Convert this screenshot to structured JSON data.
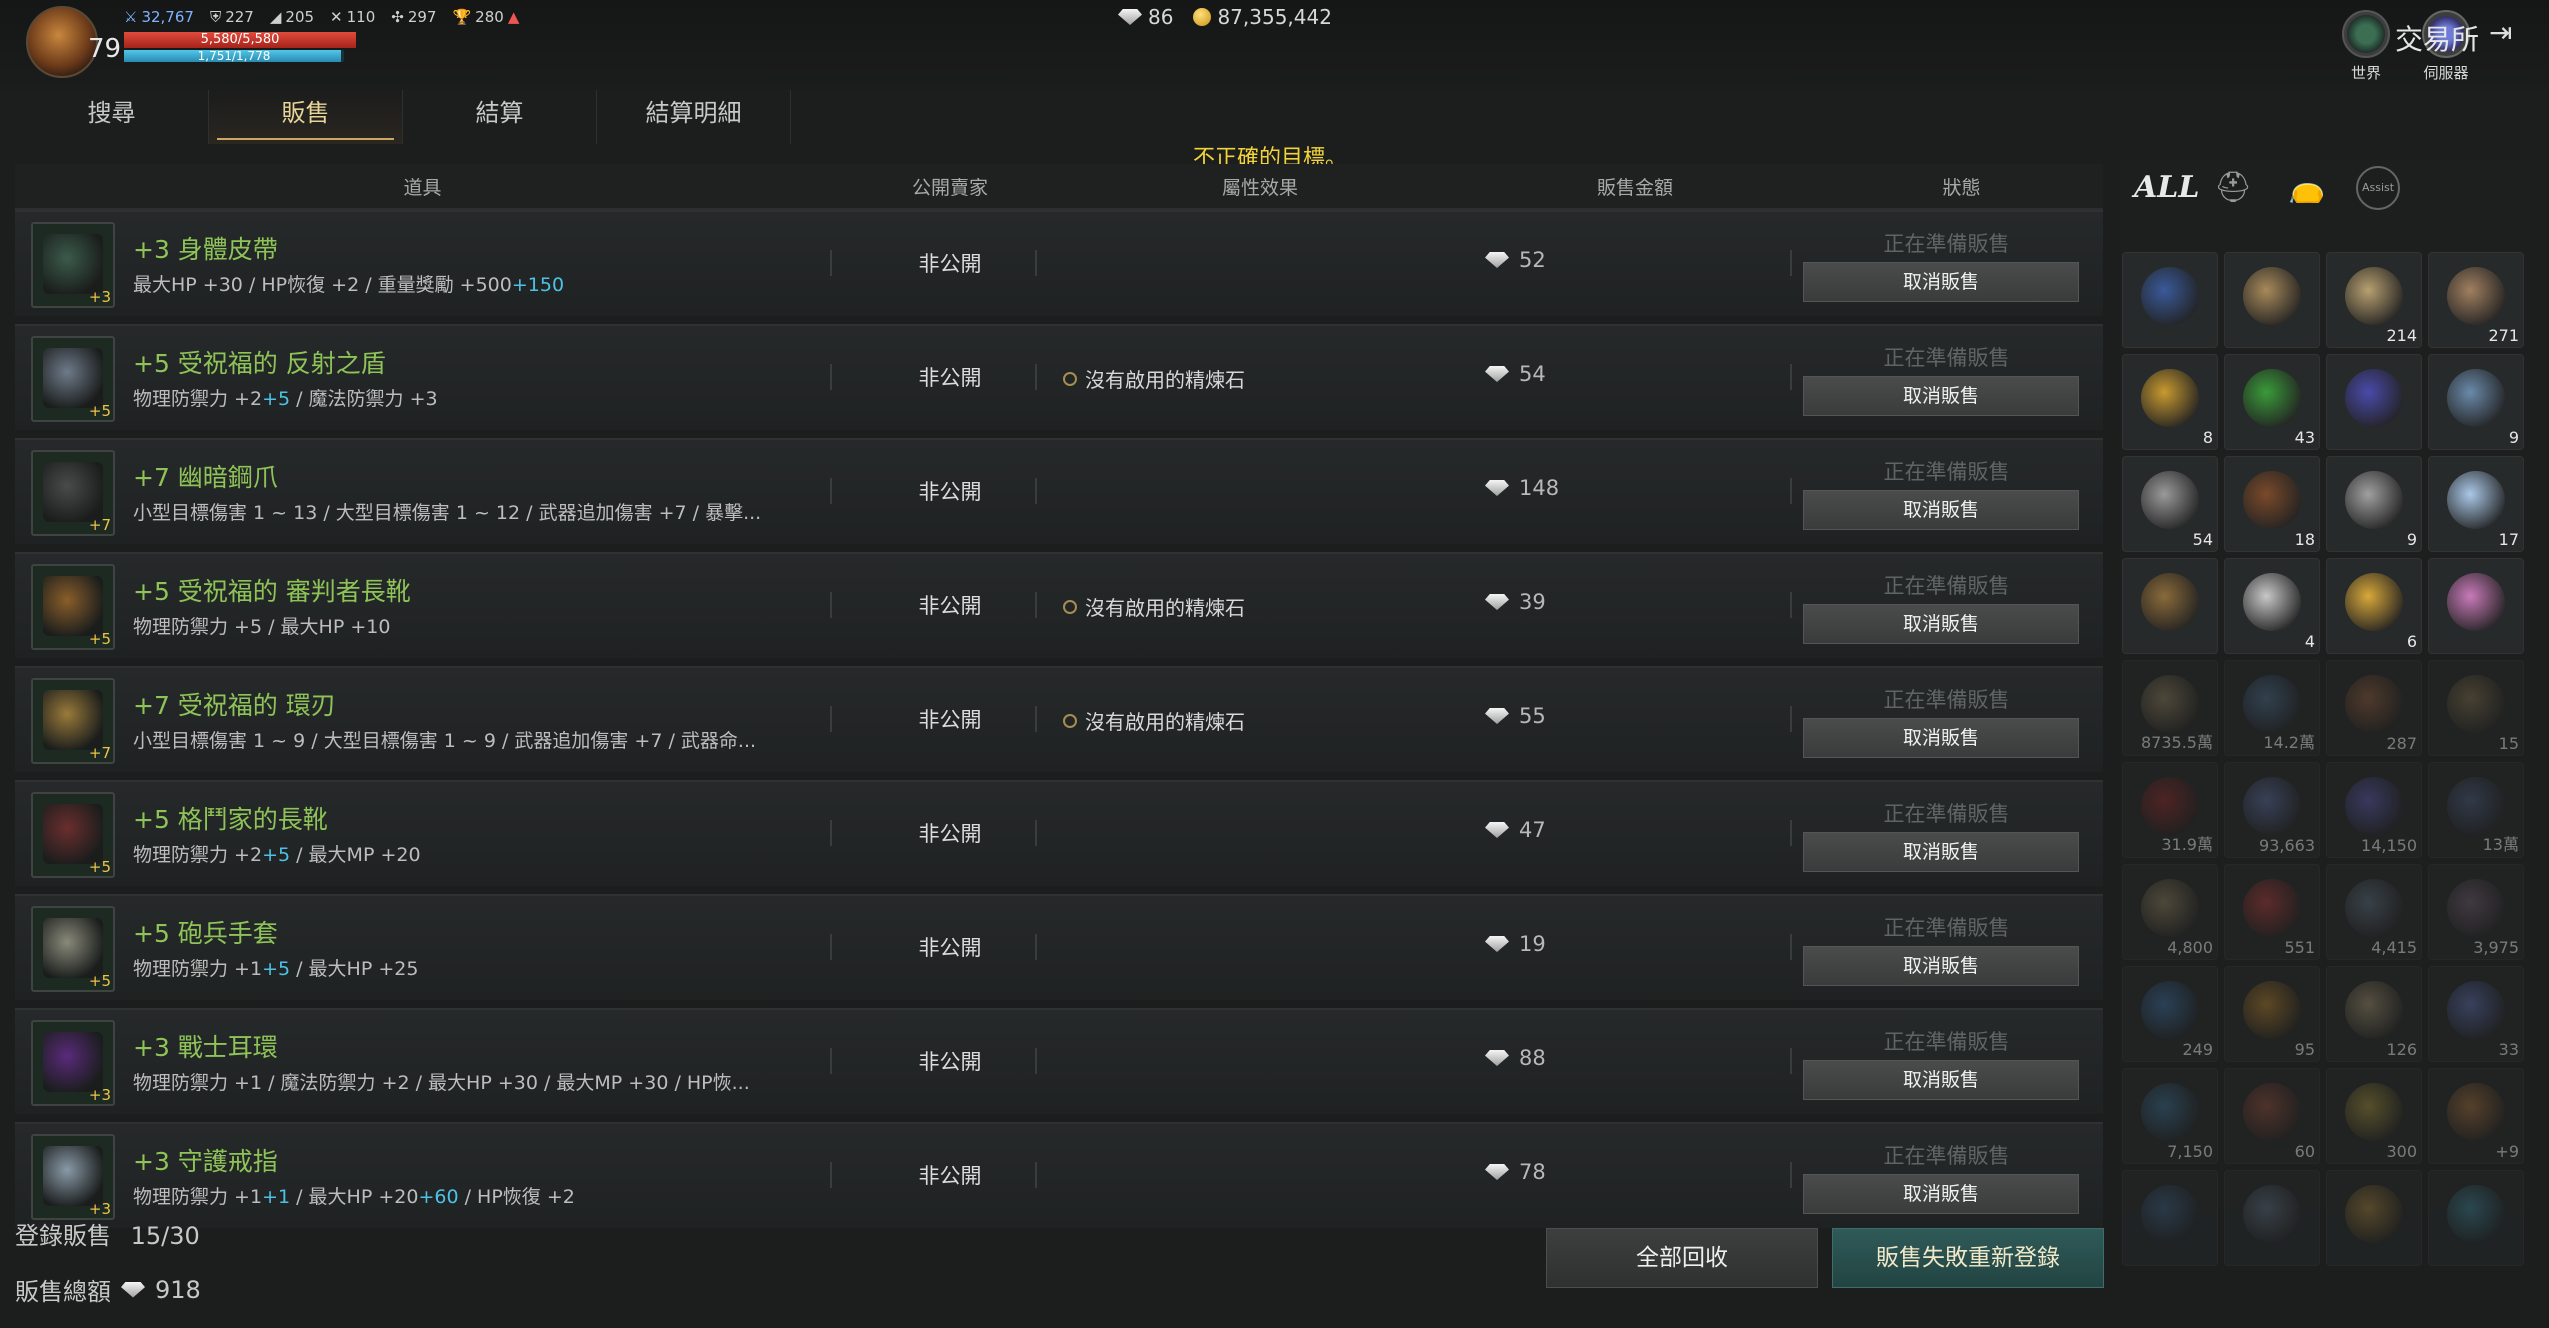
{
  "hud": {
    "level": "79",
    "stats": [
      "32,767",
      "227",
      "205",
      "110",
      "297",
      "280"
    ],
    "hp_text": "5,580/5,580",
    "mp_text": "1,751/1,778",
    "hp_fraction": 1.0,
    "mp_fraction": 0.985,
    "diamonds": "86",
    "gold": "87,355,442",
    "world_label": "世界",
    "server_label": "伺服器",
    "market_title": "交易所"
  },
  "tabs": [
    "搜尋",
    "販售",
    "結算",
    "結算明細"
  ],
  "active_tab": 1,
  "error_message": "不正確的目標。",
  "headers": {
    "item": "道具",
    "seller": "公開賣家",
    "attr": "屬性效果",
    "price": "販售金額",
    "status": "狀態"
  },
  "rows": [
    {
      "icon": "belt-icon",
      "plus": "+3",
      "name": "+3 身體皮帶",
      "desc": "最大HP +30 / HP恢復 +2 / 重量獎勵 +500",
      "desc_extra": "+150",
      "seller": "非公開",
      "attr": "",
      "price": "52",
      "status": "正在準備販售",
      "cancel": "取消販售",
      "color": "#3b5b4a"
    },
    {
      "icon": "shield-icon",
      "plus": "+5",
      "name": "+5 受祝福的 反射之盾",
      "desc": "物理防禦力 +2",
      "desc_extra": "+5",
      "desc_tail": " / 魔法防禦力 +3",
      "seller": "非公開",
      "attr": "沒有啟用的精煉石",
      "price": "54",
      "status": "正在準備販售",
      "cancel": "取消販售",
      "color": "#6f7a8a"
    },
    {
      "icon": "claw-icon",
      "plus": "+7",
      "name": "+7 幽暗鋼爪",
      "desc": "小型目標傷害 1 ~ 13 / 大型目標傷害 1 ~ 12 / 武器追加傷害 +7 / 暴擊...",
      "seller": "非公開",
      "attr": "",
      "price": "148",
      "status": "正在準備販售",
      "cancel": "取消販售",
      "color": "#4a4a4a"
    },
    {
      "icon": "boots-icon",
      "plus": "+5",
      "name": "+5 受祝福的 審判者長靴",
      "desc": "物理防禦力 +5 / 最大HP +10",
      "seller": "非公開",
      "attr": "沒有啟用的精煉石",
      "price": "39",
      "status": "正在準備販售",
      "cancel": "取消販售",
      "color": "#8a5e2a"
    },
    {
      "icon": "ring-blade-icon",
      "plus": "+7",
      "name": "+7 受祝福的 環刃",
      "desc": "小型目標傷害 1 ~ 9 / 大型目標傷害 1 ~ 9 / 武器追加傷害 +7 / 武器命...",
      "seller": "非公開",
      "attr": "沒有啟用的精煉石",
      "price": "55",
      "status": "正在準備販售",
      "cancel": "取消販售",
      "color": "#9a7a3a"
    },
    {
      "icon": "boots-icon",
      "plus": "+5",
      "name": "+5 格鬥家的長靴",
      "desc": "物理防禦力 +2",
      "desc_extra": "+5",
      "desc_tail": " / 最大MP +20",
      "seller": "非公開",
      "attr": "",
      "price": "47",
      "status": "正在準備販售",
      "cancel": "取消販售",
      "color": "#6a2e2e"
    },
    {
      "icon": "gauntlet-icon",
      "plus": "+5",
      "name": "+5 砲兵手套",
      "desc": "物理防禦力 +1",
      "desc_extra": "+5",
      "desc_tail": " / 最大HP +25",
      "seller": "非公開",
      "attr": "",
      "price": "19",
      "status": "正在準備販售",
      "cancel": "取消販售",
      "color": "#8a8a7a"
    },
    {
      "icon": "earring-icon",
      "plus": "+3",
      "name": "+3 戰士耳環",
      "desc": "物理防禦力 +1 / 魔法防禦力 +2 / 最大HP +30 / 最大MP +30 / HP恢...",
      "seller": "非公開",
      "attr": "",
      "price": "88",
      "status": "正在準備販售",
      "cancel": "取消販售",
      "color": "#5a2a7a"
    },
    {
      "icon": "ring-icon",
      "plus": "+3",
      "name": "+3 守護戒指",
      "desc": "物理防禦力 +1",
      "desc_extra": "+1",
      "desc_tail": " / 最大HP +20",
      "desc_extra2": "+60",
      "desc_tail2": " / HP恢復 +2",
      "seller": "非公開",
      "attr": "",
      "price": "78",
      "status": "正在準備販售",
      "cancel": "取消販售",
      "color": "#8a9aa8"
    }
  ],
  "footer": {
    "registered_label": "登錄販售",
    "registered_value": "15/30",
    "total_label": "販售總額",
    "total_value": "918",
    "recall_button": "全部回收",
    "relist_button": "販售失敗重新登錄"
  },
  "inventory": {
    "tabs": [
      "ALL",
      "helmet-icon",
      "bag-icon",
      "Assist"
    ],
    "slots": [
      {
        "name": "emblem",
        "count": "",
        "color": "#3a5a9a"
      },
      {
        "name": "scroll-2",
        "count": "",
        "color": "#a88a5a"
      },
      {
        "name": "scroll",
        "count": "214",
        "color": "#b8a070"
      },
      {
        "name": "scroll-star",
        "count": "271",
        "color": "#a08060"
      },
      {
        "name": "gold-crystal",
        "count": "8",
        "color": "#c89a30"
      },
      {
        "name": "green-crystal",
        "count": "43",
        "color": "#3a9a3a"
      },
      {
        "name": "blue-gem",
        "count": "",
        "color": "#4a4aaa"
      },
      {
        "name": "potion-blue",
        "count": "9",
        "color": "#6a8aaa"
      },
      {
        "name": "potion-grey",
        "count": "54",
        "color": "#9a9a9a"
      },
      {
        "name": "leather",
        "count": "18",
        "color": "#7a4a2a"
      },
      {
        "name": "bones",
        "count": "9",
        "color": "#a0a0a0"
      },
      {
        "name": "beads",
        "count": "17",
        "color": "#aac8e8"
      },
      {
        "name": "logs",
        "count": "",
        "color": "#8a6a3a"
      },
      {
        "name": "thread",
        "count": "4",
        "color": "#c8c8c8"
      },
      {
        "name": "gold-ore",
        "count": "6",
        "color": "#d8a83a"
      },
      {
        "name": "rainbow-gem",
        "count": "",
        "color": "#c87ab8"
      },
      {
        "name": "coin-pile",
        "count": "8735.5萬",
        "color": "#8a7a5a"
      },
      {
        "name": "medal-a",
        "count": "14.2萬",
        "color": "#4a6a8a"
      },
      {
        "name": "doll",
        "count": "287",
        "color": "#8a5a3a"
      },
      {
        "name": "paw-coin",
        "count": "15",
        "color": "#7a6a4a"
      },
      {
        "name": "red-coin",
        "count": "31.9萬",
        "color": "#8a2a2a"
      },
      {
        "name": "blue-coin-a",
        "count": "93,663",
        "color": "#5a6a9a"
      },
      {
        "name": "blue-coin-b",
        "count": "14,150",
        "color": "#5a5aaa"
      },
      {
        "name": "blue-coin-c",
        "count": "13萬",
        "color": "#4a5a7a"
      },
      {
        "name": "stone-coin",
        "count": "4,800",
        "color": "#8a7a5a"
      },
      {
        "name": "red-x-coin",
        "count": "551",
        "color": "#aa3a3a"
      },
      {
        "name": "dark-shard",
        "count": "4,415",
        "color": "#5a6a7a"
      },
      {
        "name": "dark-shard-b",
        "count": "3,975",
        "color": "#6a5a6a"
      },
      {
        "name": "infinity-coin",
        "count": "249",
        "color": "#3a6a9a"
      },
      {
        "name": "lv-coin",
        "count": "95",
        "color": "#aa7a2a"
      },
      {
        "name": "map-scroll",
        "count": "126",
        "color": "#9a8a6a"
      },
      {
        "name": "egg",
        "count": "33",
        "color": "#5a6aaa"
      },
      {
        "name": "eye-orb",
        "count": "7,150",
        "color": "#3a6a8a"
      },
      {
        "name": "portal",
        "count": "60",
        "color": "#8a4a3a"
      },
      {
        "name": "rune-coin",
        "count": "300",
        "color": "#9a8a3a"
      },
      {
        "name": "rod",
        "count": "+9",
        "color": "#9a6a3a"
      },
      {
        "name": "partial-a",
        "count": "",
        "color": "#3a5a7a"
      },
      {
        "name": "partial-b",
        "count": "",
        "color": "#5a6a7a"
      },
      {
        "name": "partial-c",
        "count": "",
        "color": "#9a7a3a"
      },
      {
        "name": "partial-d",
        "count": "",
        "color": "#3a7a8a"
      }
    ]
  }
}
